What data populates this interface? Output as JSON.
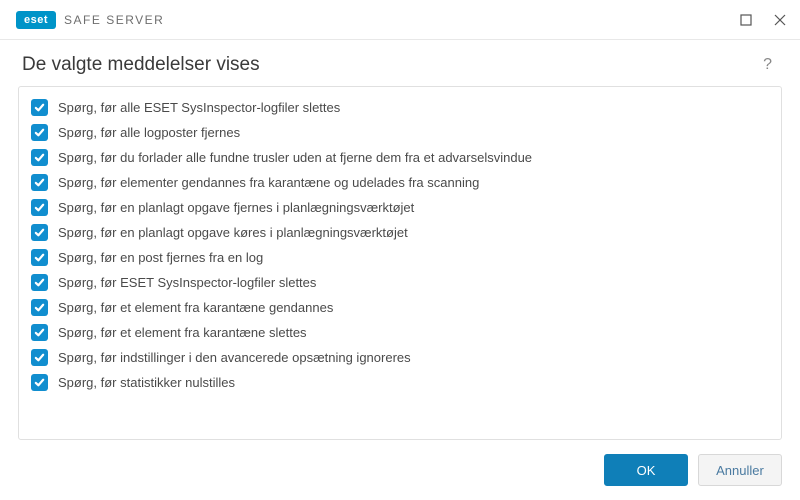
{
  "brand": {
    "logo": "eset",
    "product": "SAFE SERVER"
  },
  "window_controls": {
    "minimize": "minimize",
    "close": "close"
  },
  "header": {
    "title": "De valgte meddelelser vises",
    "help": "?"
  },
  "list": {
    "items": [
      {
        "checked": true,
        "label": "Spørg, før alle ESET SysInspector-logfiler slettes"
      },
      {
        "checked": true,
        "label": "Spørg, før alle logposter fjernes"
      },
      {
        "checked": true,
        "label": "Spørg, før du forlader alle fundne trusler uden at fjerne dem fra et advarselsvindue"
      },
      {
        "checked": true,
        "label": "Spørg, før elementer gendannes fra karantæne og udelades fra scanning"
      },
      {
        "checked": true,
        "label": "Spørg, før en planlagt opgave fjernes i planlægningsværktøjet"
      },
      {
        "checked": true,
        "label": "Spørg, før en planlagt opgave køres i planlægningsværktøjet"
      },
      {
        "checked": true,
        "label": "Spørg, før en post fjernes fra en log"
      },
      {
        "checked": true,
        "label": "Spørg, før ESET SysInspector-logfiler slettes"
      },
      {
        "checked": true,
        "label": "Spørg, før et element fra karantæne gendannes"
      },
      {
        "checked": true,
        "label": "Spørg, før et element fra karantæne slettes"
      },
      {
        "checked": true,
        "label": "Spørg, før indstillinger i den avancerede opsætning ignoreres"
      },
      {
        "checked": true,
        "label": "Spørg, før statistikker nulstilles"
      }
    ]
  },
  "footer": {
    "ok": "OK",
    "cancel": "Annuller"
  },
  "colors": {
    "accent": "#118ecf",
    "primary_btn": "#0f7fb8"
  }
}
